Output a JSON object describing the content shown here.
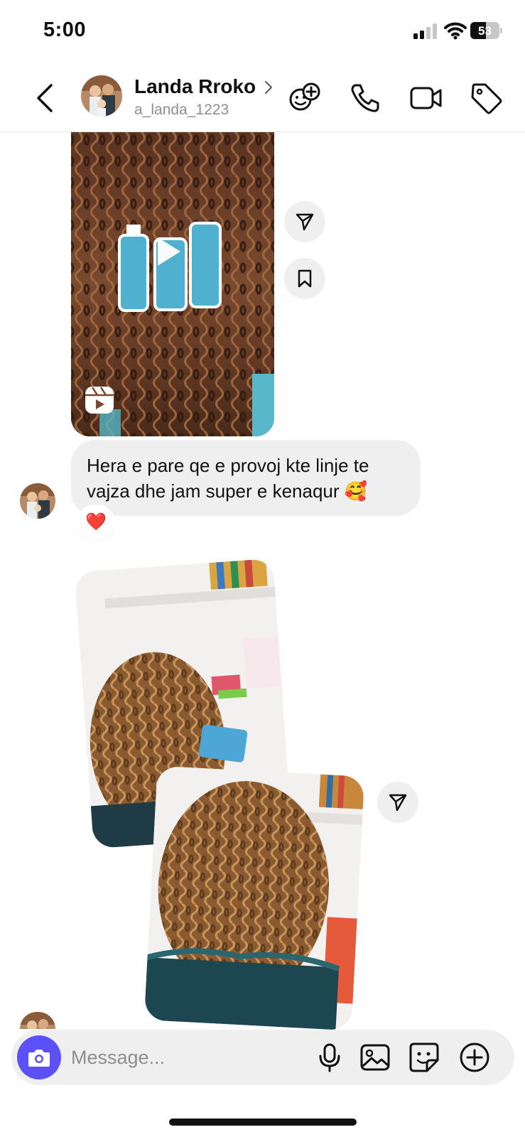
{
  "status_bar": {
    "time": "5:00",
    "battery_level": "53"
  },
  "header": {
    "contact_name": "Landa Rroko",
    "username": "a_landa_1223"
  },
  "messages": {
    "text": "Hera e pare qe e provoj kte linje te vajza dhe jam super e kenaqur 🥰",
    "reaction": "❤️"
  },
  "composer": {
    "placeholder": "Message..."
  },
  "colors": {
    "accent": "#5b51f6",
    "bubble": "#efefef",
    "secondary_text": "#8e8e8e"
  },
  "icons": [
    "back-icon",
    "chevron-right-icon",
    "add-group-icon",
    "phone-icon",
    "video-icon",
    "tag-icon",
    "share-icon",
    "bookmark-icon",
    "reels-icon",
    "play-icon",
    "camera-icon",
    "microphone-icon",
    "gallery-icon",
    "sticker-icon",
    "plus-icon"
  ]
}
